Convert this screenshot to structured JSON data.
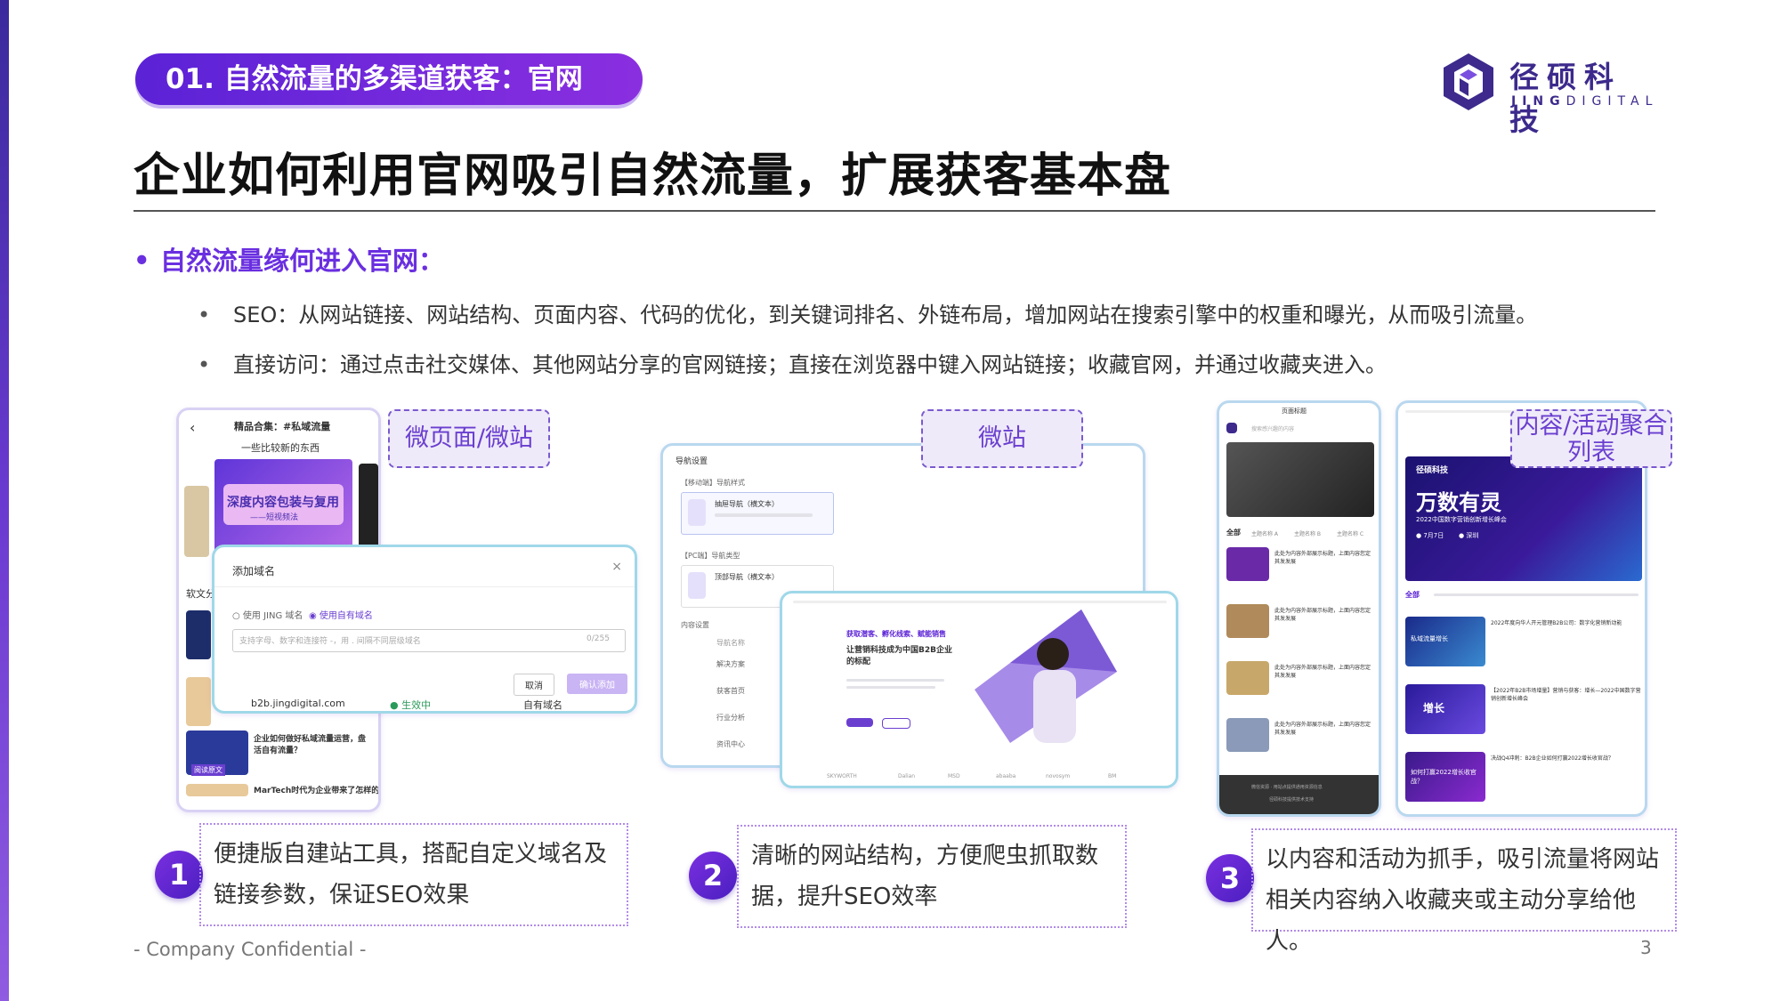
{
  "section_pill": "01. 自然流量的多渠道获客：官网",
  "logo": {
    "cn": "径硕科技",
    "en_bold": "JING",
    "en_rest": "DIGITAL"
  },
  "headline": "企业如何利用官网吸引自然流量，扩展获客基本盘",
  "subhead": "自然流量缘何进入官网：",
  "points": [
    "SEO：从网站链接、网站结构、页面内容、代码的优化，到关键词排名、外链布局，增加网站在搜索引擎中的权重和曝光，从而吸引流量。",
    "直接访问：通过点击社交媒体、其他网站分享的官网链接；直接在浏览器中键入网站链接；收藏官网，并通过收藏夹进入。"
  ],
  "panels": [
    {
      "number": "1",
      "tag": "微页面/微站",
      "caption": "便捷版自建站工具，搭配自定义域名及链接参数，保证SEO效果",
      "mock": {
        "phone_title": "精品合集：#私域流量",
        "phone_subtitle": "一些比较新的东西",
        "banner_title": "深度内容包装与复用",
        "banner_sub": "——短视频法",
        "list_label": "软文分",
        "modal_title": "添加域名",
        "radio_a": "使用 JING 域名",
        "radio_b": "使用自有域名",
        "input_placeholder": "支持字母、数字和连接符 -，用 . 间隔不同层级域名",
        "input_count": "0/255",
        "cancel": "取消",
        "confirm": "确认添加",
        "domain": "b2b.jingdigital.com",
        "status": "● 生效中",
        "type": "自有域名",
        "article_title": "企业如何做好私域流量运营，盘活自有流量？",
        "article_tag": "阅读原文",
        "bottom_text": "MarTech时代为企业带来了怎样的机"
      }
    },
    {
      "number": "2",
      "tag": "微站",
      "caption": "清晰的网站结构，方便爬虫抓取数据，提升SEO效率",
      "mock": {
        "nav_title": "导航设置",
        "mobile_label": "【移动端】导航样式",
        "mobile_item": "抽屉导航（横文本）",
        "pc_label": "【PC端】导航类型",
        "pc_item": "顶部导航（横文本）",
        "content_label": "内容设置",
        "col_head": "导航名称",
        "rows": [
          "解决方案",
          "获客首页",
          "行业分析",
          "资讯中心"
        ],
        "hero_line1": "获取潜客、孵化线索、赋能销售",
        "hero_line2": "让营销科技成为中国B2B企业的标配",
        "partners": [
          "SKYWORTH",
          "Dalian",
          "MSD",
          "abaaba",
          "novosym",
          "BM"
        ]
      }
    },
    {
      "number": "3",
      "tag": "内容/活动聚合列表",
      "caption": "以内容和活动为抓手，吸引流量将网站相关内容纳入收藏夹或主动分享给他人。",
      "mock": {
        "left_title": "页面标题",
        "left_search": "搜索感兴趣的内容",
        "tab_all": "全部",
        "tabs": [
          "主题名称 A",
          "主题名称 B",
          "主题名称 C"
        ],
        "item_title": "此处为内容外部展示标题，上面内容您定其发发展",
        "footer_line1": "微信资源 · 用站点提供通用资源信息",
        "footer_line2": "径硕科技提供技术支持",
        "event_brand": "径硕科技",
        "event_title": "万数有灵",
        "event_sub": "2022中国数字营销创新增长峰会",
        "event_date": "7月7日",
        "event_place": "深圳",
        "event_tab": "全部",
        "event_items": [
          "2022年度向华人开元管理B2B公司：数字化营销新动能",
          "【2022年B2B市场增量】营销与获客：增长—2022中国数字营销创新增长峰会",
          "决战Q4冲刺：B2B企业如何打赢2022增长收官战？"
        ],
        "thumb1": "私域流量增长",
        "thumb2": "增长",
        "thumb3": "如何打赢2022增长收官战？"
      }
    }
  ],
  "footer": "- Company Confidential -",
  "page_number": "3",
  "colors": {
    "accent": "#6a2fe0",
    "pill_start": "#5b22d6",
    "pill_end": "#8a2fe0",
    "logo": "#3d2a8c"
  }
}
